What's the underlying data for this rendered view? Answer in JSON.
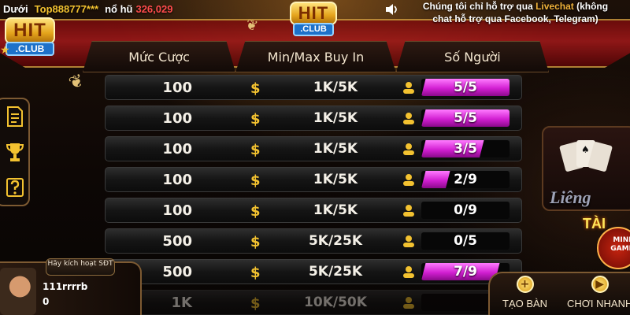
{
  "ticker": {
    "prefix": "Dưới",
    "player": "Top888777***",
    "jackpot_label": "nổ hũ",
    "jackpot_amount": "326,029"
  },
  "logo": {
    "hit": "HIT",
    "club": ".CLUB"
  },
  "support": {
    "line1": "Chúng tôi chỉ hỗ trợ qua ",
    "livechat": "Livechat",
    "line1_tail": " (không",
    "line2": "chat hỗ trợ qua Facebook, Telegram)"
  },
  "table": {
    "headers": [
      "Mức Cược",
      "Min/Max Buy In",
      "Số Người"
    ],
    "rows": [
      {
        "bet": "100",
        "buyin": "1K/5K",
        "players": "5/5",
        "fill": 1.0
      },
      {
        "bet": "100",
        "buyin": "1K/5K",
        "players": "5/5",
        "fill": 1.0
      },
      {
        "bet": "100",
        "buyin": "1K/5K",
        "players": "3/5",
        "fill": 0.6
      },
      {
        "bet": "100",
        "buyin": "1K/5K",
        "players": "2/9",
        "fill": 0.22
      },
      {
        "bet": "100",
        "buyin": "1K/5K",
        "players": "0/9",
        "fill": 0.0
      },
      {
        "bet": "500",
        "buyin": "5K/25K",
        "players": "0/5",
        "fill": 0.0
      },
      {
        "bet": "500",
        "buyin": "5K/25K",
        "players": "7/9",
        "fill": 0.78
      },
      {
        "bet": "1K",
        "buyin": "10K/50K",
        "players": "",
        "fill": 0.0
      }
    ],
    "colors": {
      "fill": "#d21fd2",
      "currency": "#f3c230"
    }
  },
  "promo": {
    "lieng": "Liêng",
    "tai": "TÀI",
    "mini": "MINI GAME"
  },
  "user": {
    "activate": "Hãy kích hoạt SĐT",
    "name": "111rrrrb",
    "balance": "0"
  },
  "buttons": {
    "create": "TẠO BÀN",
    "play": "CHƠI NHANH"
  }
}
